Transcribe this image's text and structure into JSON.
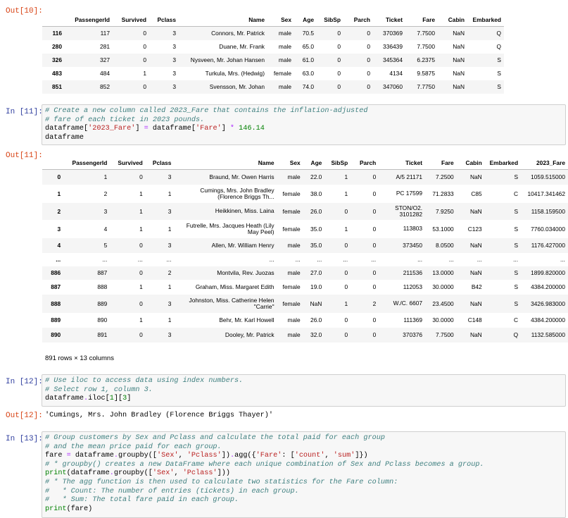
{
  "cells": {
    "out10": {
      "prompt": "Out[10]:",
      "columns": [
        "",
        "PassengerId",
        "Survived",
        "Pclass",
        "Name",
        "Sex",
        "Age",
        "SibSp",
        "Parch",
        "Ticket",
        "Fare",
        "Cabin",
        "Embarked"
      ],
      "rows": [
        [
          "116",
          "117",
          "0",
          "3",
          "Connors, Mr. Patrick",
          "male",
          "70.5",
          "0",
          "0",
          "370369",
          "7.7500",
          "NaN",
          "Q"
        ],
        [
          "280",
          "281",
          "0",
          "3",
          "Duane, Mr. Frank",
          "male",
          "65.0",
          "0",
          "0",
          "336439",
          "7.7500",
          "NaN",
          "Q"
        ],
        [
          "326",
          "327",
          "0",
          "3",
          "Nysveen, Mr. Johan Hansen",
          "male",
          "61.0",
          "0",
          "0",
          "345364",
          "6.2375",
          "NaN",
          "S"
        ],
        [
          "483",
          "484",
          "1",
          "3",
          "Turkula, Mrs. (Hedwig)",
          "female",
          "63.0",
          "0",
          "0",
          "4134",
          "9.5875",
          "NaN",
          "S"
        ],
        [
          "851",
          "852",
          "0",
          "3",
          "Svensson, Mr. Johan",
          "male",
          "74.0",
          "0",
          "0",
          "347060",
          "7.7750",
          "NaN",
          "S"
        ]
      ]
    },
    "in11": {
      "prompt": "In [11]:",
      "lines": [
        [
          {
            "c": "cm",
            "t": "# Create a new column called 2023_Fare that contains the inflation-adjusted"
          }
        ],
        [
          {
            "c": "cm",
            "t": "# fare of each ticket in 2023 pounds."
          }
        ],
        [
          {
            "c": "plain",
            "t": "dataframe["
          },
          {
            "c": "st",
            "t": "'2023_Fare'"
          },
          {
            "c": "plain",
            "t": "] "
          },
          {
            "c": "op",
            "t": "="
          },
          {
            "c": "plain",
            "t": " dataframe["
          },
          {
            "c": "st",
            "t": "'Fare'"
          },
          {
            "c": "plain",
            "t": "] "
          },
          {
            "c": "op",
            "t": "*"
          },
          {
            "c": "plain",
            "t": " "
          },
          {
            "c": "num",
            "t": "146.14"
          }
        ],
        [
          {
            "c": "plain",
            "t": "dataframe"
          }
        ]
      ]
    },
    "out11": {
      "prompt": "Out[11]:",
      "columns": [
        "",
        "PassengerId",
        "Survived",
        "Pclass",
        "Name",
        "Sex",
        "Age",
        "SibSp",
        "Parch",
        "Ticket",
        "Fare",
        "Cabin",
        "Embarked",
        "2023_Fare"
      ],
      "rows": [
        [
          "0",
          "1",
          "0",
          "3",
          "Braund, Mr. Owen Harris",
          "male",
          "22.0",
          "1",
          "0",
          "A/5 21171",
          "7.2500",
          "NaN",
          "S",
          "1059.515000"
        ],
        [
          "1",
          "2",
          "1",
          "1",
          "Cumings, Mrs. John Bradley (Florence Briggs Th...",
          "female",
          "38.0",
          "1",
          "0",
          "PC 17599",
          "71.2833",
          "C85",
          "C",
          "10417.341462"
        ],
        [
          "2",
          "3",
          "1",
          "3",
          "Heikkinen, Miss. Laina",
          "female",
          "26.0",
          "0",
          "0",
          "STON/O2. 3101282",
          "7.9250",
          "NaN",
          "S",
          "1158.159500"
        ],
        [
          "3",
          "4",
          "1",
          "1",
          "Futrelle, Mrs. Jacques Heath (Lily May Peel)",
          "female",
          "35.0",
          "1",
          "0",
          "113803",
          "53.1000",
          "C123",
          "S",
          "7760.034000"
        ],
        [
          "4",
          "5",
          "0",
          "3",
          "Allen, Mr. William Henry",
          "male",
          "35.0",
          "0",
          "0",
          "373450",
          "8.0500",
          "NaN",
          "S",
          "1176.427000"
        ],
        [
          "...",
          "...",
          "...",
          "...",
          "...",
          "...",
          "...",
          "...",
          "...",
          "...",
          "...",
          "...",
          "...",
          "..."
        ],
        [
          "886",
          "887",
          "0",
          "2",
          "Montvila, Rev. Juozas",
          "male",
          "27.0",
          "0",
          "0",
          "211536",
          "13.0000",
          "NaN",
          "S",
          "1899.820000"
        ],
        [
          "887",
          "888",
          "1",
          "1",
          "Graham, Miss. Margaret Edith",
          "female",
          "19.0",
          "0",
          "0",
          "112053",
          "30.0000",
          "B42",
          "S",
          "4384.200000"
        ],
        [
          "888",
          "889",
          "0",
          "3",
          "Johnston, Miss. Catherine Helen \"Carrie\"",
          "female",
          "NaN",
          "1",
          "2",
          "W./C. 6607",
          "23.4500",
          "NaN",
          "S",
          "3426.983000"
        ],
        [
          "889",
          "890",
          "1",
          "1",
          "Behr, Mr. Karl Howell",
          "male",
          "26.0",
          "0",
          "0",
          "111369",
          "30.0000",
          "C148",
          "C",
          "4384.200000"
        ],
        [
          "890",
          "891",
          "0",
          "3",
          "Dooley, Mr. Patrick",
          "male",
          "32.0",
          "0",
          "0",
          "370376",
          "7.7500",
          "NaN",
          "Q",
          "1132.585000"
        ]
      ],
      "rows_note": "891 rows × 13 columns"
    },
    "in12": {
      "prompt": "In [12]:",
      "lines": [
        [
          {
            "c": "cm",
            "t": "# Use iloc to access data using index numbers."
          }
        ],
        [
          {
            "c": "cm",
            "t": "# Select row 1, column 3."
          }
        ],
        [
          {
            "c": "plain",
            "t": "dataframe"
          },
          {
            "c": "op",
            "t": "."
          },
          {
            "c": "plain",
            "t": "iloc["
          },
          {
            "c": "num",
            "t": "1"
          },
          {
            "c": "plain",
            "t": "]["
          },
          {
            "c": "num",
            "t": "3"
          },
          {
            "c": "plain",
            "t": "]"
          }
        ]
      ]
    },
    "out12": {
      "prompt": "Out[12]:",
      "text": "'Cumings, Mrs. John Bradley (Florence Briggs Thayer)'"
    },
    "in13": {
      "prompt": "In [13]:",
      "lines": [
        [
          {
            "c": "cm",
            "t": "# Group customers by Sex and Pclass and calculate the total paid for each group"
          }
        ],
        [
          {
            "c": "cm",
            "t": "# and the mean price paid for each group."
          }
        ],
        [
          {
            "c": "plain",
            "t": "fare "
          },
          {
            "c": "op",
            "t": "="
          },
          {
            "c": "plain",
            "t": " dataframe"
          },
          {
            "c": "op",
            "t": "."
          },
          {
            "c": "plain",
            "t": "groupby(["
          },
          {
            "c": "st",
            "t": "'Sex'"
          },
          {
            "c": "plain",
            "t": ", "
          },
          {
            "c": "st",
            "t": "'Pclass'"
          },
          {
            "c": "plain",
            "t": "])"
          },
          {
            "c": "op",
            "t": "."
          },
          {
            "c": "plain",
            "t": "agg({"
          },
          {
            "c": "st",
            "t": "'Fare'"
          },
          {
            "c": "plain",
            "t": ": ["
          },
          {
            "c": "st",
            "t": "'count'"
          },
          {
            "c": "plain",
            "t": ", "
          },
          {
            "c": "st",
            "t": "'sum'"
          },
          {
            "c": "plain",
            "t": "]})"
          }
        ],
        [
          {
            "c": "cm",
            "t": "# * groupby() creates a new DataFrame where each unique combination of Sex and Pclass becomes a group."
          }
        ],
        [
          {
            "c": "nm",
            "t": "print"
          },
          {
            "c": "plain",
            "t": "(dataframe"
          },
          {
            "c": "op",
            "t": "."
          },
          {
            "c": "plain",
            "t": "groupby(["
          },
          {
            "c": "st",
            "t": "'Sex'"
          },
          {
            "c": "plain",
            "t": ", "
          },
          {
            "c": "st",
            "t": "'Pclass'"
          },
          {
            "c": "plain",
            "t": "]))"
          }
        ],
        [
          {
            "c": "cm",
            "t": "# * The agg function is then used to calculate two statistics for the Fare column:"
          }
        ],
        [
          {
            "c": "cm",
            "t": "#   * Count: The number of entries (tickets) in each group."
          }
        ],
        [
          {
            "c": "cm",
            "t": "#   * Sum: The total fare paid in each group."
          }
        ],
        [
          {
            "c": "nm",
            "t": "print"
          },
          {
            "c": "plain",
            "t": "(fare)"
          }
        ]
      ]
    }
  }
}
